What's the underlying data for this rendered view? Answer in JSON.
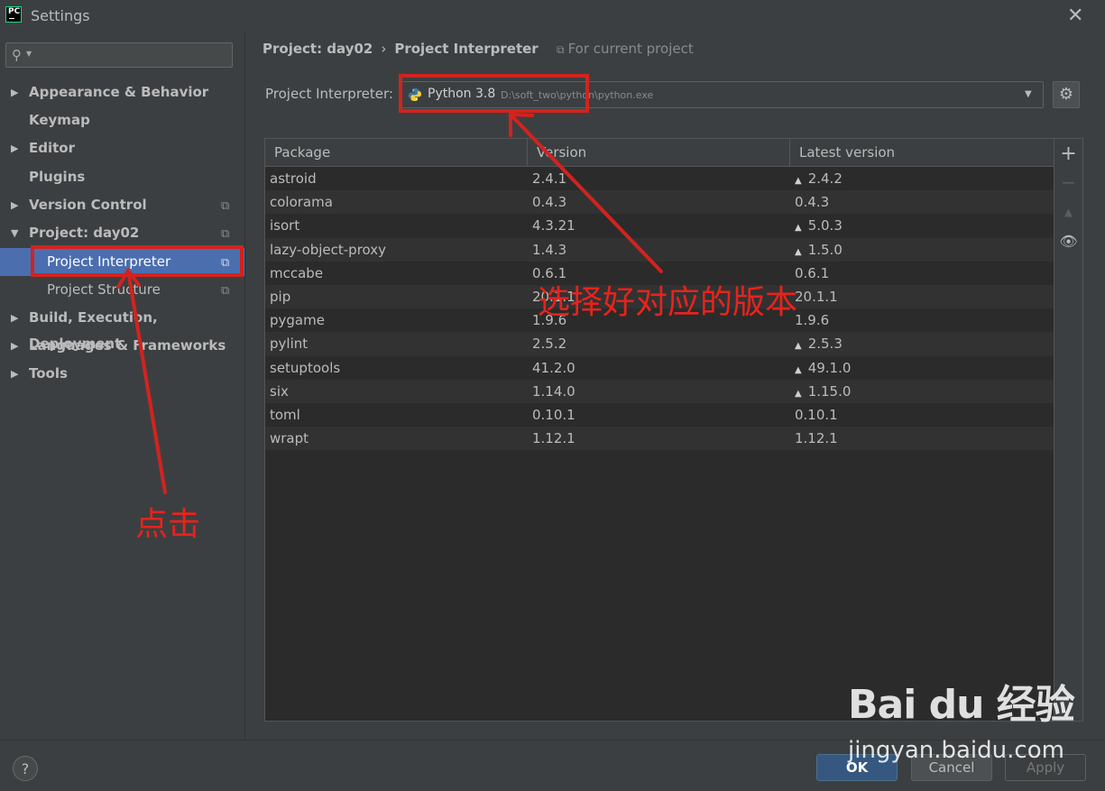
{
  "window": {
    "title": "Settings"
  },
  "sidebar": {
    "search_placeholder": "",
    "items": [
      {
        "label": "Appearance & Behavior",
        "arrow": "▶"
      },
      {
        "label": "Keymap",
        "arrow": ""
      },
      {
        "label": "Editor",
        "arrow": "▶"
      },
      {
        "label": "Plugins",
        "arrow": ""
      },
      {
        "label": "Version Control",
        "arrow": "▶"
      },
      {
        "label": "Project: day02",
        "arrow": "▼"
      },
      {
        "label": "Project Interpreter",
        "arrow": ""
      },
      {
        "label": "Project Structure",
        "arrow": ""
      },
      {
        "label": "Build, Execution, Deployment",
        "arrow": "▶"
      },
      {
        "label": "Languages & Frameworks",
        "arrow": "▶"
      },
      {
        "label": "Tools",
        "arrow": "▶"
      }
    ]
  },
  "breadcrumb": {
    "project": "Project: day02",
    "separator": "›",
    "page": "Project Interpreter"
  },
  "scope": {
    "label": "For current project"
  },
  "interpreter": {
    "label": "Project Interpreter:",
    "name": "Python 3.8",
    "path": "D:\\soft_two\\python\\python.exe"
  },
  "table": {
    "headers": [
      "Package",
      "Version",
      "Latest version"
    ],
    "rows": [
      {
        "package": "astroid",
        "version": "2.4.1",
        "latest": "2.4.2",
        "upgrade": true
      },
      {
        "package": "colorama",
        "version": "0.4.3",
        "latest": "0.4.3",
        "upgrade": false
      },
      {
        "package": "isort",
        "version": "4.3.21",
        "latest": "5.0.3",
        "upgrade": true
      },
      {
        "package": "lazy-object-proxy",
        "version": "1.4.3",
        "latest": "1.5.0",
        "upgrade": true
      },
      {
        "package": "mccabe",
        "version": "0.6.1",
        "latest": "0.6.1",
        "upgrade": false
      },
      {
        "package": "pip",
        "version": "20.1.1",
        "latest": "20.1.1",
        "upgrade": false
      },
      {
        "package": "pygame",
        "version": "1.9.6",
        "latest": "1.9.6",
        "upgrade": false
      },
      {
        "package": "pylint",
        "version": "2.5.2",
        "latest": "2.5.3",
        "upgrade": true
      },
      {
        "package": "setuptools",
        "version": "41.2.0",
        "latest": "49.1.0",
        "upgrade": true
      },
      {
        "package": "six",
        "version": "1.14.0",
        "latest": "1.15.0",
        "upgrade": true
      },
      {
        "package": "toml",
        "version": "0.10.1",
        "latest": "0.10.1",
        "upgrade": false
      },
      {
        "package": "wrapt",
        "version": "1.12.1",
        "latest": "1.12.1",
        "upgrade": false
      }
    ]
  },
  "tools": {
    "add": "+",
    "remove": "−",
    "upgrade": "▲",
    "show": "👁"
  },
  "footer": {
    "help": "?",
    "ok": "OK",
    "cancel": "Cancel",
    "apply": "Apply"
  },
  "annotations": {
    "click_text": "点击",
    "choose_text": "选择好对应的版本"
  },
  "watermark": {
    "brand": "Bai du 经验",
    "site": "jingyan.baidu.com"
  },
  "colors": {
    "accent": "#4b6eaf",
    "annotation": "#d2231e",
    "background": "#3c3f41",
    "table_bg": "#2b2b2b"
  }
}
